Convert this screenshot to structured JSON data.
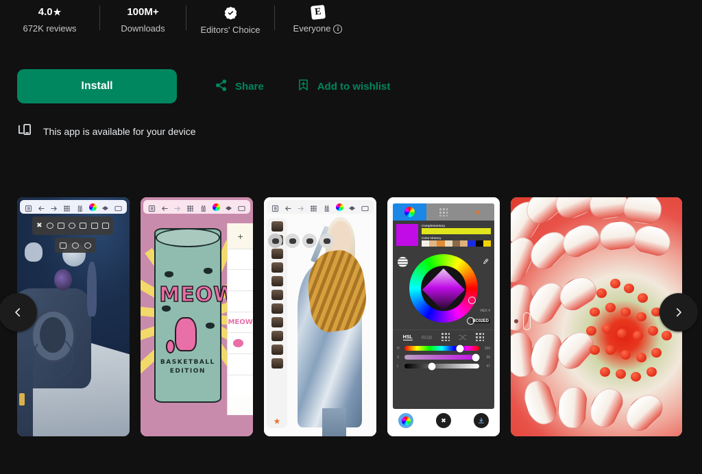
{
  "stats": [
    {
      "value": "4.0",
      "icon": "star-icon",
      "label": "672K reviews",
      "type": "rating"
    },
    {
      "value": "100M+",
      "icon": "",
      "label": "Downloads",
      "type": "downloads"
    },
    {
      "value": "",
      "icon": "editors-choice-badge-icon",
      "label": "Editors' Choice",
      "type": "badge"
    },
    {
      "value": "",
      "icon": "content-rating-e-icon",
      "label": "Everyone",
      "info": "i",
      "type": "rating-everyone"
    }
  ],
  "actions": {
    "install_label": "Install",
    "install_color": "#01875f",
    "share_label": "Share",
    "wishlist_label": "Add to wishlist",
    "accent_color": "#01875f"
  },
  "availability": {
    "icon": "device-phone-icon",
    "text": "This app is available for your device"
  },
  "carousel": {
    "prev_label": "‹",
    "next_label": "›",
    "screenshots": [
      {
        "name": "screenshot-space-painting",
        "alt": "Digital painting of an astronaut and lunar rover with app toolbar"
      },
      {
        "name": "screenshot-meow-can",
        "alt": "Illustration of a MEOW basketball edition soda can",
        "can_text": "MEOW",
        "caption_line1": "BASKETBALL",
        "caption_line2": "EDITION",
        "panel_plus": "+",
        "thumb_label": "MEOW"
      },
      {
        "name": "screenshot-warrior-character",
        "alt": "Character illustration of a blonde warrior in a blue coat with fur collar",
        "star": "★"
      },
      {
        "name": "screenshot-color-picker",
        "alt": "Color picker panel with HSL wheel and sliders",
        "tabs": [
          "color-wheel-tab",
          "palette-grid-tab",
          "favorites-star-tab"
        ],
        "complementary_label": "Complementary",
        "history_label": "Color History",
        "hex_label": "HEX #",
        "hex_value": "BC02ED",
        "modes": [
          "HSL",
          "RGB",
          "grid",
          "shuffle",
          "sliders"
        ],
        "active_mode": "HSL",
        "sliders": [
          {
            "label": "H",
            "value": "289",
            "pos": 74
          },
          {
            "label": "S",
            "value": "98",
            "pos": 95
          },
          {
            "label": "L",
            "value": "47",
            "pos": 37
          }
        ],
        "swatch_color": "#c10ce8",
        "complementary_color": "#e0e61b",
        "history_colors": [
          "#f5f0e6",
          "#e0b684",
          "#e08a33",
          "#e8d9bd",
          "#8a6a48",
          "#e0b07a",
          "#1a2ae0",
          "#0a0a0a",
          "#f2d400"
        ],
        "bottom_buttons": [
          "color-wheel-button",
          "close-button",
          "download-button"
        ]
      },
      {
        "name": "screenshot-flower-dahlia",
        "alt": "Vector illustration of a red and white dahlia flower"
      }
    ]
  },
  "theme": {
    "background": "#111111",
    "text_primary": "#ffffff",
    "text_secondary": "#c4c7c5",
    "accent": "#01875f"
  }
}
